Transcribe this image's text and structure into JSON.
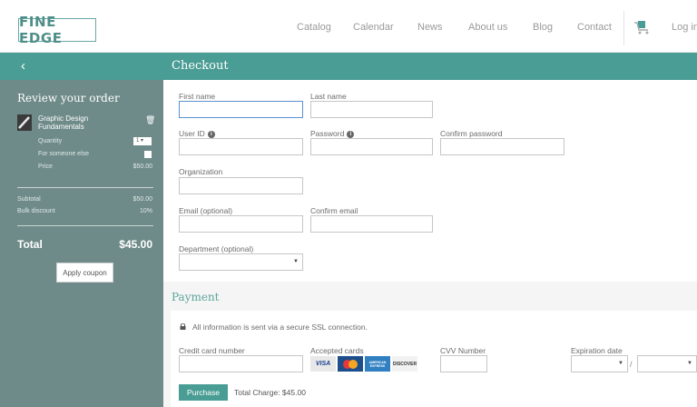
{
  "brand": {
    "logo": "FINE EDGE",
    "accent": "#4a9d94"
  },
  "nav": {
    "links": [
      "Catalog",
      "Calendar",
      "News",
      "About us",
      "Blog",
      "Contact"
    ],
    "login": "Log in",
    "cart_icon": "cart-icon"
  },
  "header": {
    "back_icon": "‹",
    "title": "Checkout"
  },
  "order": {
    "title": "Review your order",
    "product": {
      "name": "Graphic Design Fundamentals",
      "quantity_label": "Quantity",
      "quantity_value": "1",
      "someone_else_label": "For someone else",
      "price_label": "Price",
      "price_value": "$50.00"
    },
    "subtotal_label": "Subtotal",
    "subtotal_value": "$50.00",
    "discount_label": "Bulk discount",
    "discount_value": "10%",
    "total_label": "Total",
    "total_value": "$45.00",
    "coupon_button": "Apply coupon"
  },
  "form": {
    "first_name": "First name",
    "last_name": "Last name",
    "user_id": "User ID",
    "password": "Password",
    "confirm_password": "Confirm password",
    "organization": "Organization",
    "email": "Email (optional)",
    "confirm_email": "Confirm email",
    "department": "Department (optional)"
  },
  "payment": {
    "title": "Payment",
    "ssl_note": "All information is sent via a secure SSL connection.",
    "card_number": "Credit card number",
    "accepted_cards": "Accepted cards",
    "cards": [
      "VISA",
      "MasterCard",
      "AMERICAN EXPRESS",
      "DISCOVER"
    ],
    "cvv": "CVV Number",
    "expiration": "Expiration date",
    "date_separator": "/",
    "purchase_button": "Purchase",
    "total_charge": "Total Charge: $45.00"
  }
}
